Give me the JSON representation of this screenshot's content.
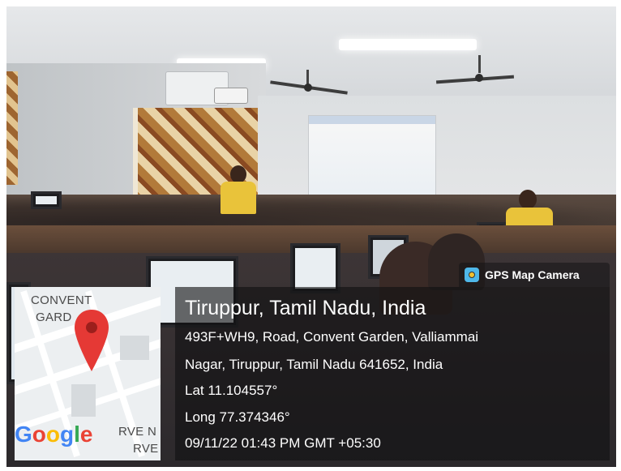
{
  "gps_camera": {
    "app_label": "GPS Map Camera",
    "icon": "gps-map-camera-icon"
  },
  "location": {
    "title": "Tiruppur, Tamil Nadu, India",
    "address_line1": "493F+WH9, Road, Convent Garden, Valliammai",
    "address_line2": "Nagar, Tiruppur, Tamil Nadu 641652, India",
    "latitude": "Lat 11.104557°",
    "longitude": "Long 77.374346°",
    "timestamp": "09/11/22 01:43 PM GMT +05:30"
  },
  "map": {
    "label_top_line1": "CONVENT",
    "label_top_line2": "GARD",
    "label_bottom_line1": "RVE N",
    "label_bottom_line2": "RVE",
    "brand": "Google",
    "pin_color": "#e53935"
  }
}
